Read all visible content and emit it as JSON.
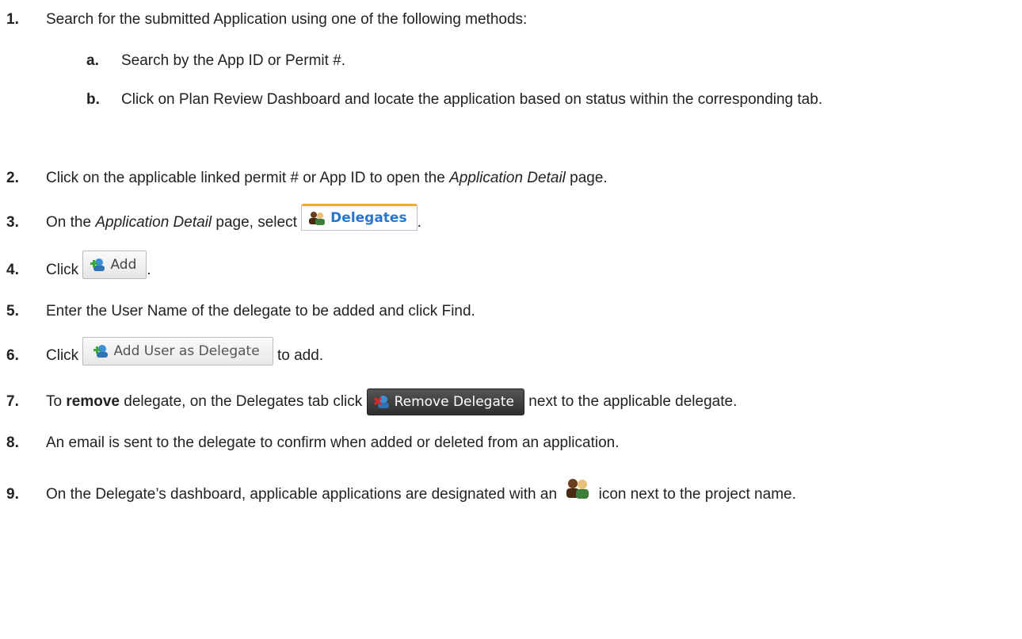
{
  "steps": [
    {
      "num": "1.",
      "text": "Search for the submitted Application using one of the following methods:"
    },
    {
      "num": "a.",
      "text": "Search by the App ID or Permit #."
    },
    {
      "num": "b.",
      "text": "Click on Plan Review Dashboard and locate the application based on status within the corresponding tab."
    },
    {
      "num": "2.",
      "pre": "Click on the applicable linked permit # or App ID to open the ",
      "em": "Application Detail",
      "post": " page."
    },
    {
      "num": "3.",
      "pre": "On the ",
      "em": "Application Detail",
      "mid": " page, select ",
      "post": "."
    },
    {
      "num": "4.",
      "pre": "Click ",
      "post": "."
    },
    {
      "num": "5.",
      "text": "Enter the User Name of the delegate to be added and click Find."
    },
    {
      "num": "6.",
      "pre": "Click ",
      "post": " to add."
    },
    {
      "num": "7.",
      "pre": "To ",
      "strong": "remove",
      "mid": " delegate, on the Delegates tab click ",
      "post": " next to the applicable delegate."
    },
    {
      "num": "8.",
      "text": "An email is sent to the delegate to confirm when added or deleted from an application."
    },
    {
      "num": "9.",
      "pre": "On the Delegate’s dashboard, applicable applications are designated with an ",
      "post": " icon next to the project name."
    }
  ],
  "buttons": {
    "delegates_tab": "Delegates",
    "add": "Add",
    "add_user_as_delegate": "Add User as Delegate",
    "remove_delegate": "Remove Delegate"
  },
  "colors": {
    "tab_text": "#2a76c7",
    "tab_accent": "#f6a828",
    "remove_button_bg": "#3a3a3a"
  },
  "icons": {
    "delegates": "delegates-people-icon",
    "add": "green-plus-user-icon",
    "remove": "red-x-user-icon"
  }
}
